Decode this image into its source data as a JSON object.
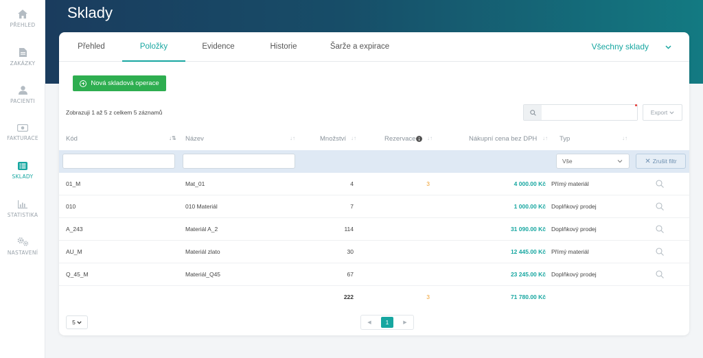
{
  "sidebar": {
    "items": [
      {
        "label": "PŘEHLED",
        "icon": "home-icon"
      },
      {
        "label": "ZAKÁZKY",
        "icon": "document-icon"
      },
      {
        "label": "PACIENTI",
        "icon": "user-icon"
      },
      {
        "label": "FAKTURACE",
        "icon": "banknote-icon"
      },
      {
        "label": "SKLADY",
        "icon": "list-icon"
      },
      {
        "label": "STATISTIKA",
        "icon": "chart-icon"
      },
      {
        "label": "NASTAVENÍ",
        "icon": "gears-icon"
      }
    ],
    "active_index": 4
  },
  "header": {
    "title": "Sklady"
  },
  "tabs": [
    {
      "label": "Přehled"
    },
    {
      "label": "Položky"
    },
    {
      "label": "Evidence"
    },
    {
      "label": "Historie"
    },
    {
      "label": "Šarže a expirace"
    }
  ],
  "active_tab": 1,
  "warehouse_select": {
    "label": "Všechny sklady"
  },
  "actions": {
    "new_operation": "Nová skladová operace",
    "export": "Export"
  },
  "info": {
    "text": "Zobrazuji 1 až 5 z celkem 5 záznamů"
  },
  "search": {
    "value": ""
  },
  "table": {
    "headers": {
      "code": "Kód",
      "name": "Název",
      "qty": "Množství",
      "reservation": "Rezervace",
      "price": "Nákupní cena bez DPH",
      "type": "Typ"
    },
    "filters": {
      "code": "",
      "name": "",
      "type": "Vše",
      "clear": "Zrušit filtr"
    },
    "rows": [
      {
        "code": "01_M",
        "name": "Mat_01",
        "qty": "4",
        "reservation": "3",
        "price": "4 000.00 Kč",
        "type": "Přímý materiál"
      },
      {
        "code": "010",
        "name": "010 Materiál",
        "qty": "7",
        "reservation": "",
        "price": "1 000.00 Kč",
        "type": "Doplňkový prodej"
      },
      {
        "code": "A_243",
        "name": "Materiál A_2",
        "qty": "114",
        "reservation": "",
        "price": "31 090.00 Kč",
        "type": "Doplňkový prodej"
      },
      {
        "code": "AU_M",
        "name": "Materiál zlato",
        "qty": "30",
        "reservation": "",
        "price": "12 445.00 Kč",
        "type": "Přímý materiál"
      },
      {
        "code": "Q_45_M",
        "name": "Materiál_Q45",
        "qty": "67",
        "reservation": "",
        "price": "23 245.00 Kč",
        "type": "Doplňkový prodej"
      }
    ],
    "totals": {
      "qty": "222",
      "reservation": "3",
      "price": "71 780.00 Kč"
    }
  },
  "pagination": {
    "page_size": "5",
    "current": "1"
  },
  "colors": {
    "accent": "#16a6a0",
    "button_green": "#2eae50",
    "reservation": "#f0a030",
    "header_dark": "#1a3c5e",
    "header_teal": "#137a82"
  }
}
